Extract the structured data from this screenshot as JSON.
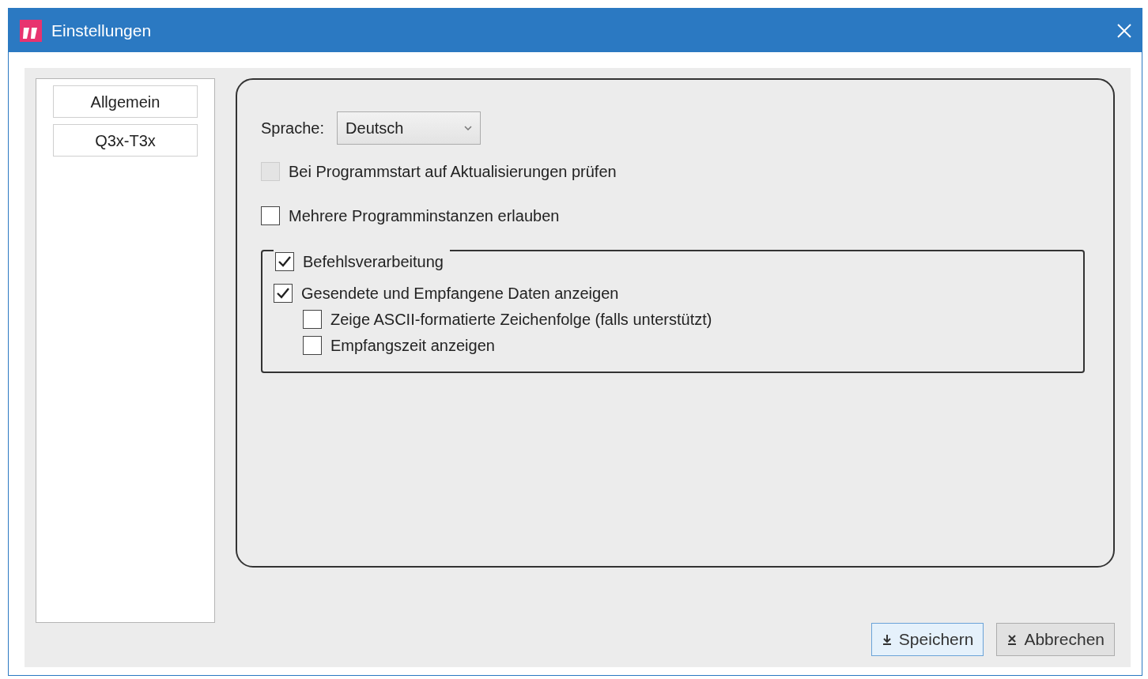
{
  "window": {
    "title": "Einstellungen"
  },
  "sidebar": {
    "items": [
      {
        "label": "Allgemein"
      },
      {
        "label": "Q3x-T3x"
      }
    ]
  },
  "language": {
    "label": "Sprache:",
    "value": "Deutsch"
  },
  "options": [
    {
      "label": "Bei Programmstart auf Aktualisierungen prüfen",
      "checked": false,
      "disabled": true
    },
    {
      "label": "Mehrere Programminstanzen erlauben",
      "checked": false,
      "disabled": false
    }
  ],
  "group": {
    "label": "Befehlsverarbeitung",
    "checked": true,
    "options": [
      {
        "label": "Gesendete und Empfangene Daten anzeigen",
        "checked": true,
        "children": [
          {
            "label": "Zeige ASCII-formatierte Zeichenfolge (falls unterstützt)",
            "checked": false
          },
          {
            "label": "Empfangszeit anzeigen",
            "checked": false
          }
        ]
      }
    ]
  },
  "buttons": [
    {
      "label": "Speichern",
      "kind": "save",
      "default": true
    },
    {
      "label": "Abbrechen",
      "kind": "cancel",
      "default": false
    }
  ]
}
